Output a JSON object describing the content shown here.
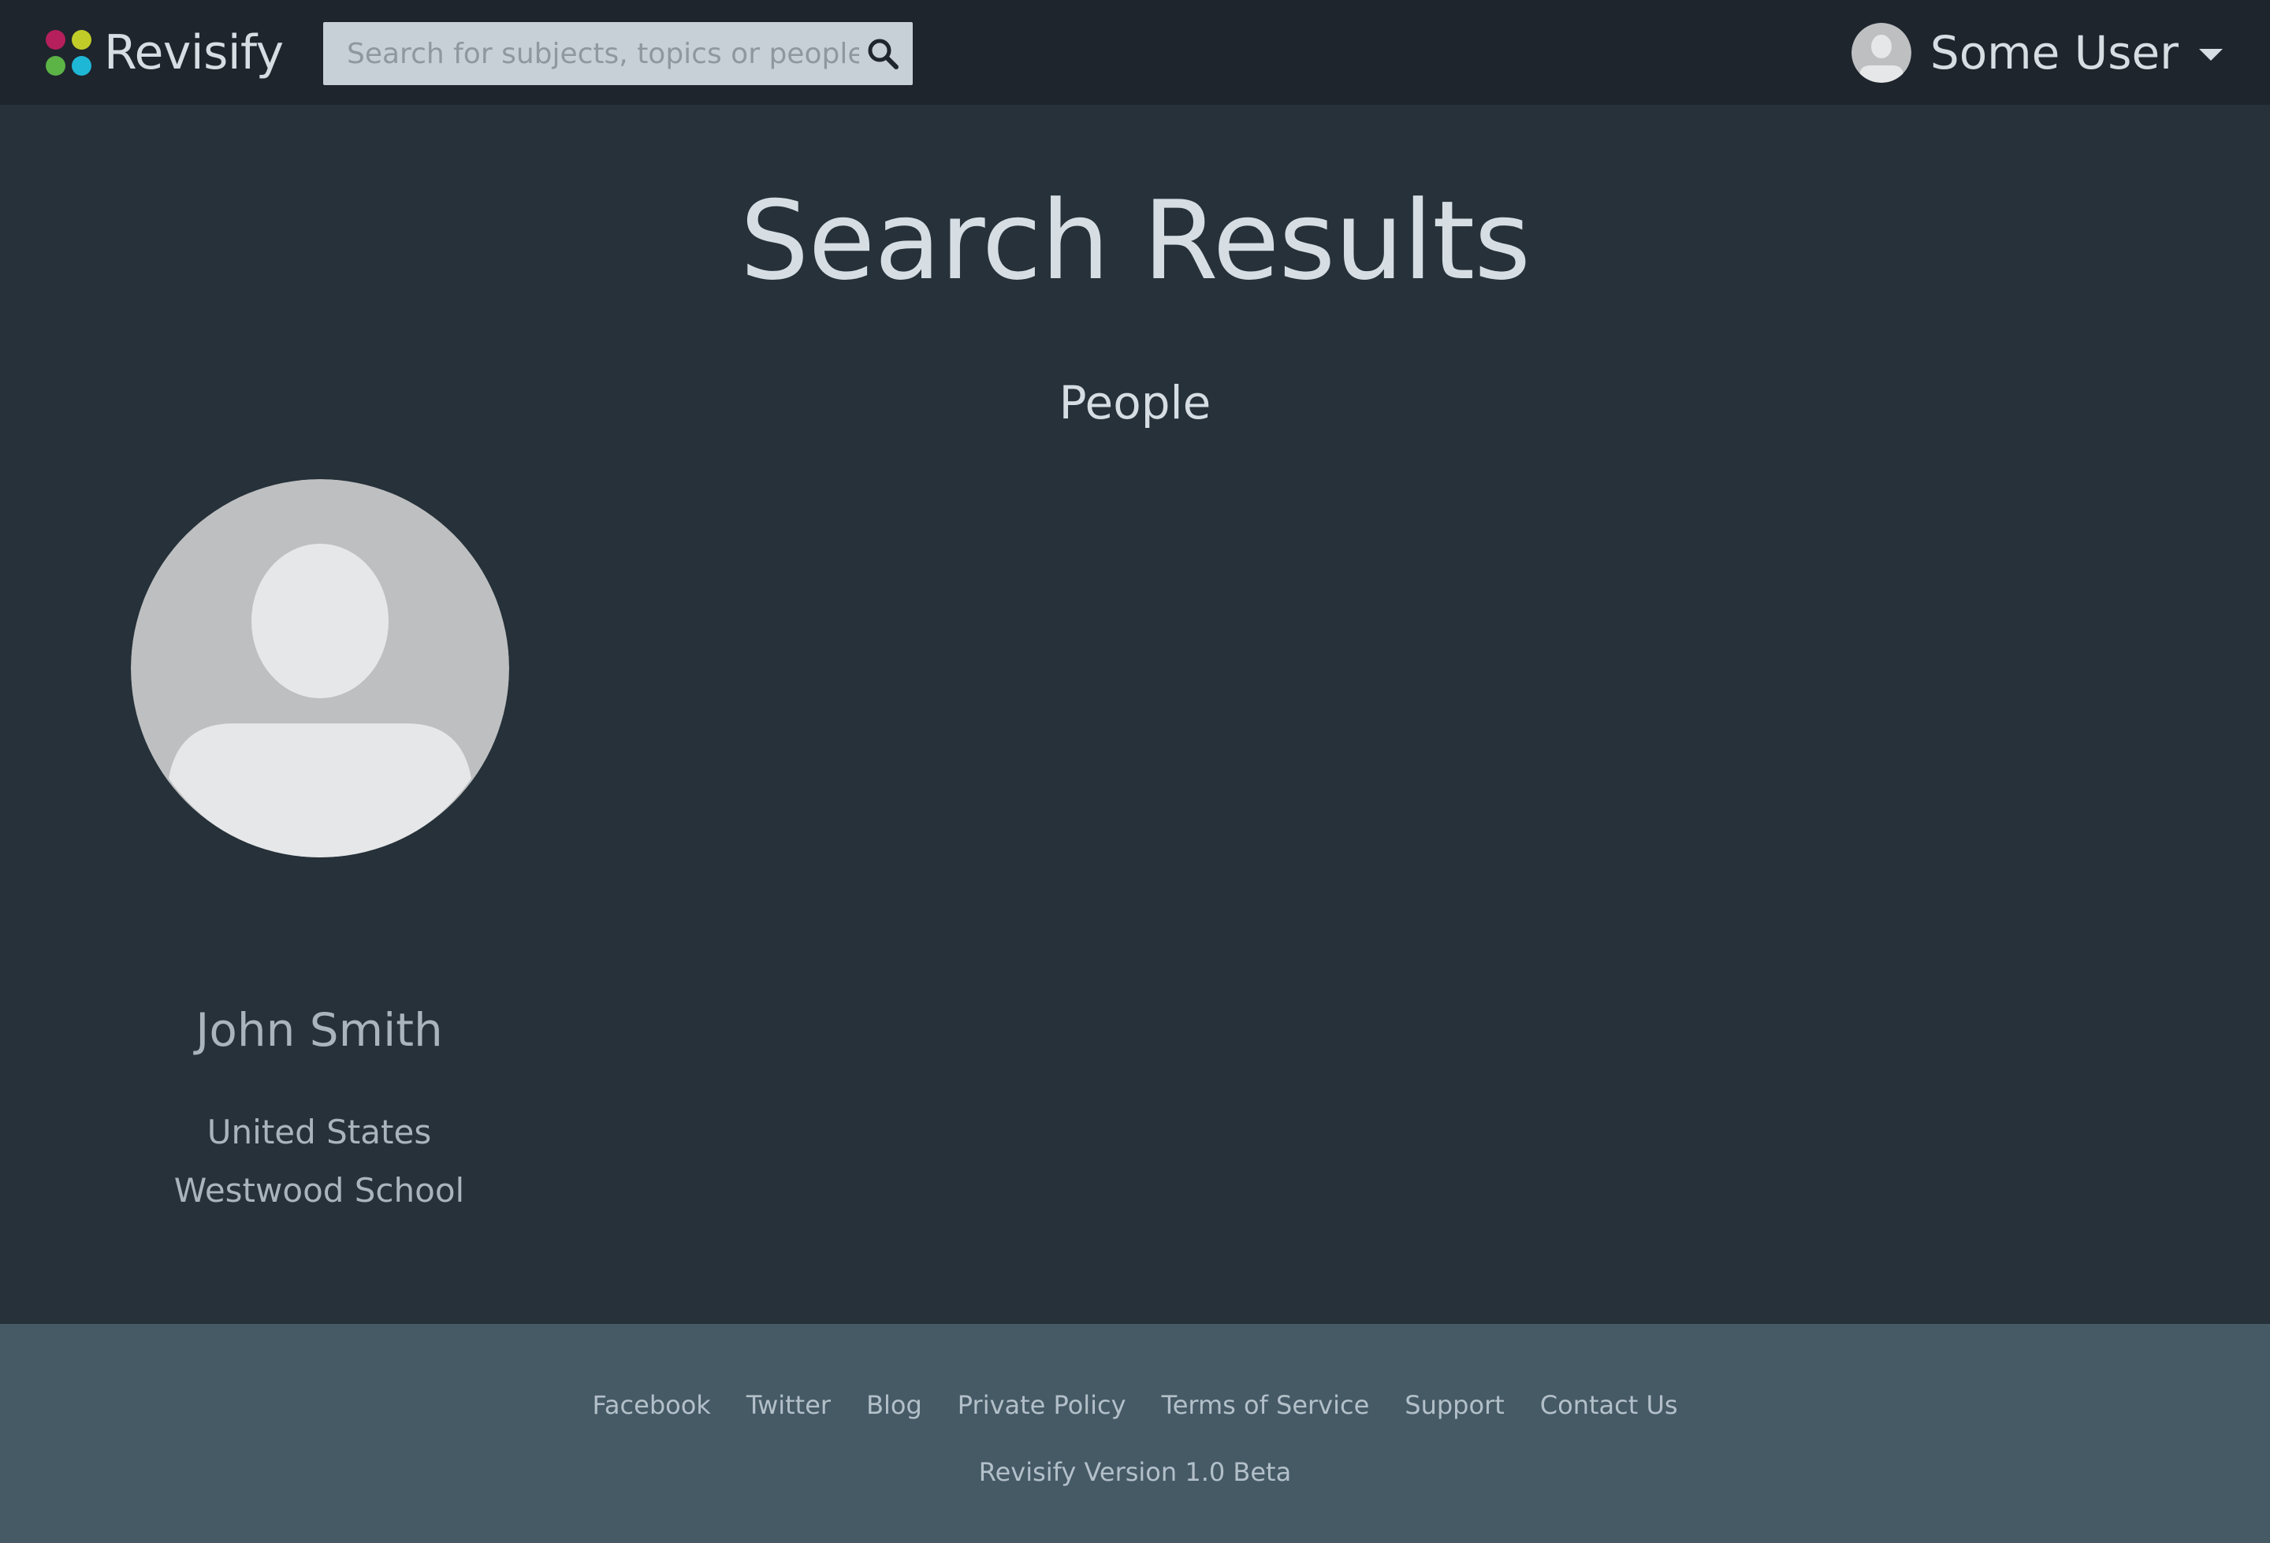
{
  "brand": {
    "name": "Revisify",
    "logo_icon": "four-dot-logo-icon",
    "dot_colors": [
      "#b51f5c",
      "#c1cc29",
      "#5cb346",
      "#1fb7d6"
    ]
  },
  "search": {
    "placeholder": "Search for subjects, topics or people",
    "value": "",
    "icon": "search-icon"
  },
  "user_menu": {
    "name": "Some User",
    "avatar_icon": "default-avatar-icon",
    "caret_icon": "caret-down-icon"
  },
  "main": {
    "title": "Search Results",
    "sections": [
      {
        "title": "People",
        "results": [
          {
            "name": "John Smith",
            "country": "United States",
            "school": "Westwood School",
            "avatar_icon": "default-avatar-icon"
          }
        ]
      }
    ]
  },
  "footer": {
    "links": [
      "Facebook",
      "Twitter",
      "Blog",
      "Private Policy",
      "Terms of Service",
      "Support",
      "Contact Us"
    ],
    "version": "Revisify Version 1.0 Beta"
  },
  "colors": {
    "navbar_bg": "#1e252d",
    "page_bg": "#263139",
    "footer_bg": "#465a66",
    "search_bg": "#c8d0d7",
    "avatar_bg": "#bdbfc1",
    "avatar_figure": "#e6e7e8"
  }
}
